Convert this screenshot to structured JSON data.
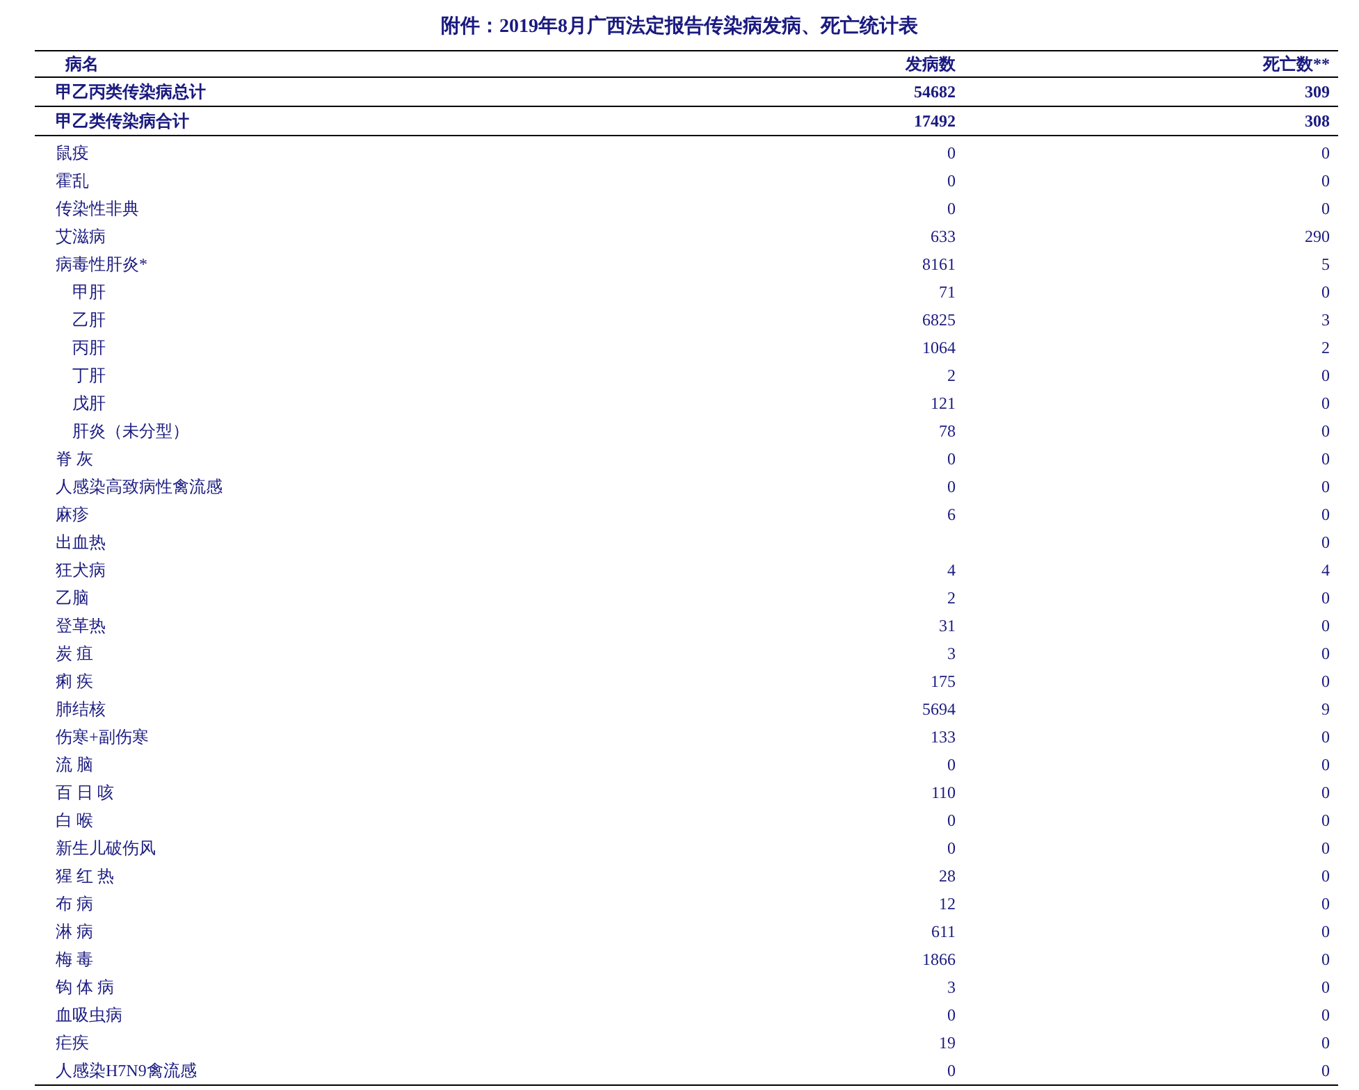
{
  "title": "附件：2019年8月广西法定报告传染病发病、死亡统计表",
  "columns": [
    "病名",
    "发病数",
    "死亡数**"
  ],
  "summary_rows": [
    {
      "name": "甲乙丙类传染病总计",
      "cases": "54682",
      "deaths": "309"
    },
    {
      "name": "甲乙类传染病合计",
      "cases": "17492",
      "deaths": "308"
    }
  ],
  "rows": [
    {
      "name": "鼠疫",
      "cases": "0",
      "deaths": "0"
    },
    {
      "name": "霍乱",
      "cases": "0",
      "deaths": "0"
    },
    {
      "name": "传染性非典",
      "cases": "0",
      "deaths": "0"
    },
    {
      "name": "艾滋病",
      "cases": "633",
      "deaths": "290"
    },
    {
      "name": "病毒性肝炎*",
      "cases": "8161",
      "deaths": "5",
      "children": [
        {
          "name": "甲肝",
          "cases": "71",
          "deaths": "0"
        },
        {
          "name": "乙肝",
          "cases": "6825",
          "deaths": "3"
        },
        {
          "name": "丙肝",
          "cases": "1064",
          "deaths": "2"
        },
        {
          "name": "丁肝",
          "cases": "2",
          "deaths": "0"
        },
        {
          "name": "戊肝",
          "cases": "121",
          "deaths": "0"
        },
        {
          "name": "肝炎（未分型）",
          "cases": "78",
          "deaths": "0"
        }
      ]
    },
    {
      "name": "脊 灰",
      "cases": "0",
      "deaths": "0"
    },
    {
      "name": "人感染高致病性禽流感",
      "cases": "0",
      "deaths": "0"
    },
    {
      "name": "麻疹",
      "cases": "6",
      "deaths": "0"
    },
    {
      "name": "出血热",
      "deaths": "0"
    },
    {
      "name": "狂犬病",
      "cases": "4",
      "deaths": "4"
    },
    {
      "name": "乙脑",
      "cases": "2",
      "deaths": "0"
    },
    {
      "name": "登革热",
      "cases": "31",
      "deaths": "0"
    },
    {
      "name": "炭 疽",
      "cases": "3",
      "deaths": "0"
    },
    {
      "name": "痢 疾",
      "cases": "175",
      "deaths": "0"
    },
    {
      "name": "肺结核",
      "cases": "5694",
      "deaths": "9"
    },
    {
      "name": "伤寒+副伤寒",
      "cases": "133",
      "deaths": "0"
    },
    {
      "name": "流 脑",
      "cases": "0",
      "deaths": "0"
    },
    {
      "name": "百 日 咳",
      "cases": "110",
      "deaths": "0"
    },
    {
      "name": "白 喉",
      "cases": "0",
      "deaths": "0"
    },
    {
      "name": "新生儿破伤风",
      "cases": "0",
      "deaths": "0"
    },
    {
      "name": "猩 红 热",
      "cases": "28",
      "deaths": "0"
    },
    {
      "name": "布 病",
      "cases": "12",
      "deaths": "0"
    },
    {
      "name": "淋 病",
      "cases": "611",
      "deaths": "0"
    },
    {
      "name": "梅 毒",
      "cases": "1866",
      "deaths": "0"
    },
    {
      "name": "钩 体 病",
      "cases": "3",
      "deaths": "0"
    },
    {
      "name": "血吸虫病",
      "cases": "0",
      "deaths": "0"
    },
    {
      "name": "疟疾",
      "cases": "19",
      "deaths": "0"
    },
    {
      "name": "人感染H7N9禽流感",
      "cases": "0",
      "deaths": "0"
    }
  ]
}
